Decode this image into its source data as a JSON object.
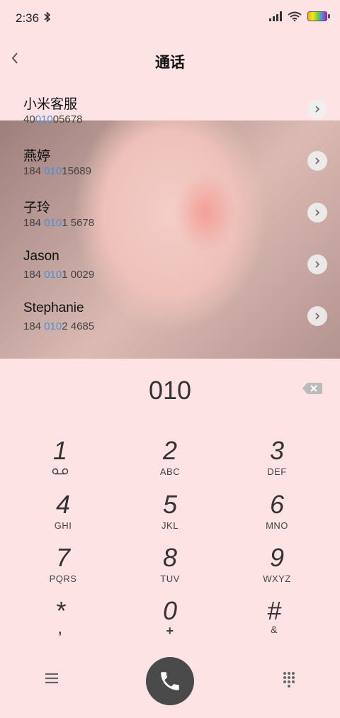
{
  "status_bar": {
    "time": "2:36"
  },
  "header": {
    "title": "通话"
  },
  "contacts": [
    {
      "name": "小米客服",
      "number_pre": "40",
      "number_match": "010",
      "number_post": "05678"
    },
    {
      "name": "燕婷",
      "number_pre": "184 ",
      "number_match": "010",
      "number_post": "15689"
    },
    {
      "name": "子玲",
      "number_pre": "184 ",
      "number_match": "010",
      "number_post": "1 5678"
    },
    {
      "name": "Jason",
      "number_pre": "184 ",
      "number_match": "010",
      "number_post": "1 0029"
    },
    {
      "name": "Stephanie",
      "number_pre": "184 ",
      "number_match": "010",
      "number_post": "2 4685"
    }
  ],
  "dialer": {
    "input": "010",
    "keys": [
      {
        "digit": "1",
        "sub": ""
      },
      {
        "digit": "2",
        "sub": "ABC"
      },
      {
        "digit": "3",
        "sub": "DEF"
      },
      {
        "digit": "4",
        "sub": "GHI"
      },
      {
        "digit": "5",
        "sub": "JKL"
      },
      {
        "digit": "6",
        "sub": "MNO"
      },
      {
        "digit": "7",
        "sub": "PQRS"
      },
      {
        "digit": "8",
        "sub": "TUV"
      },
      {
        "digit": "9",
        "sub": "WXYZ"
      },
      {
        "digit": "*",
        "sub": ","
      },
      {
        "digit": "0",
        "sub": "+"
      },
      {
        "digit": "#",
        "sub": "&"
      }
    ]
  },
  "icons": {
    "back": "back-icon",
    "detail": "chevron-right-icon",
    "backspace": "backspace-icon",
    "voicemail": "voicemail-icon",
    "menu": "menu-icon",
    "call": "phone-icon",
    "keypad": "keypad-icon"
  },
  "colors": {
    "background": "#fde3e3",
    "match_highlight": "#4a8fd9",
    "call_button": "#4a4a4a"
  }
}
